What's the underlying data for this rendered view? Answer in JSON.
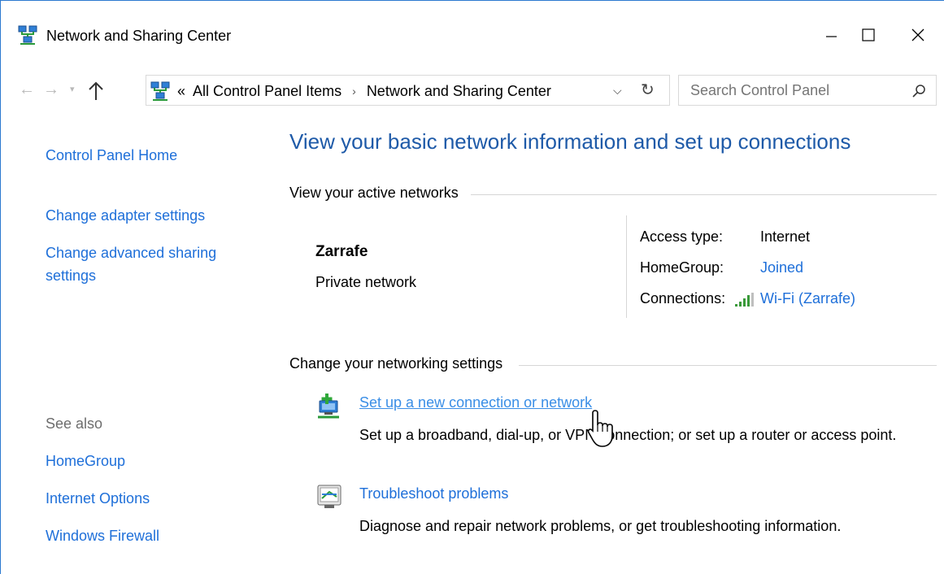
{
  "window": {
    "title": "Network and Sharing Center",
    "controls": {
      "minimize": "minimize",
      "maximize": "maximize",
      "close": "close"
    }
  },
  "address_bar": {
    "overflow": "«",
    "crumbs": [
      "All Control Panel Items",
      "Network and Sharing Center"
    ],
    "separator": "›"
  },
  "search": {
    "placeholder": "Search Control Panel",
    "value": ""
  },
  "left_nav": {
    "items": [
      {
        "label": "Control Panel Home"
      },
      {
        "label": "Change adapter settings"
      },
      {
        "label": "Change advanced sharing"
      },
      {
        "label": "settings"
      }
    ],
    "see_also_label": "See also",
    "see_also": [
      {
        "label": "HomeGroup"
      },
      {
        "label": "Internet Options"
      },
      {
        "label": "Windows Firewall"
      }
    ]
  },
  "main": {
    "heading": "View your basic network information and set up connections",
    "active_networks_label": "View your active networks",
    "network": {
      "name": "Zarrafe",
      "category": "Private network",
      "access_type_label": "Access type:",
      "access_type_value": "Internet",
      "homegroup_label": "HomeGroup:",
      "homegroup_value": "Joined",
      "connections_label": "Connections:",
      "connections_value": "Wi-Fi (Zarrafe)"
    },
    "change_settings_label": "Change your networking settings",
    "tasks": [
      {
        "title": "Set up a new connection or network",
        "description": "Set up a broadband, dial-up, or VPN connection; or set up a router or access point."
      },
      {
        "title": "Troubleshoot problems",
        "description": "Diagnose and repair network problems, or get troubleshooting information."
      }
    ]
  },
  "colors": {
    "link": "#1e6fd9",
    "heading": "#1e5aa8",
    "window_border": "#2b79d0"
  }
}
